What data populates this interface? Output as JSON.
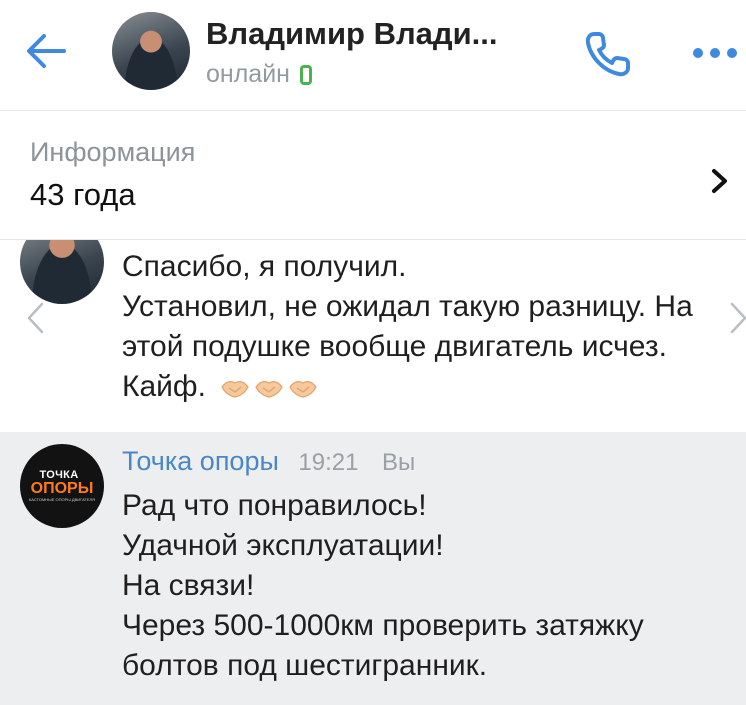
{
  "header": {
    "name": "Владимир Влади...",
    "status": "онлайн",
    "icons": [
      "arrow-left-icon",
      "phone-icon",
      "more-horizontal-icon",
      "mobile-online-icon"
    ],
    "accent_color": "#3f8ae0",
    "online_color": "#4bb34b"
  },
  "info": {
    "label": "Информация",
    "value": "43 года"
  },
  "messages": [
    {
      "lines": [
        "Спасибо, я получил.",
        "Установил, не ожидал такую разницу. На",
        "этой подушке вообще двигатель исчез.",
        "Кайф."
      ],
      "emoji": [
        "handshake",
        "handshake",
        "handshake"
      ]
    },
    {
      "sender": "Точка опоры",
      "time": "19:21",
      "you_label": "Вы",
      "avatar_logo": {
        "line1": "ТОЧКА",
        "line2": "ОПОРЫ",
        "line3": "КАСТОМНЫЕ ОПОРЫ ДВИГАТЕЛЯ"
      },
      "lines": [
        "Рад что понравилось!",
        "Удачной эксплуатации!",
        "На связи!",
        "Через 500-1000км проверить затяжку",
        "болтов под шестигранник."
      ]
    }
  ]
}
